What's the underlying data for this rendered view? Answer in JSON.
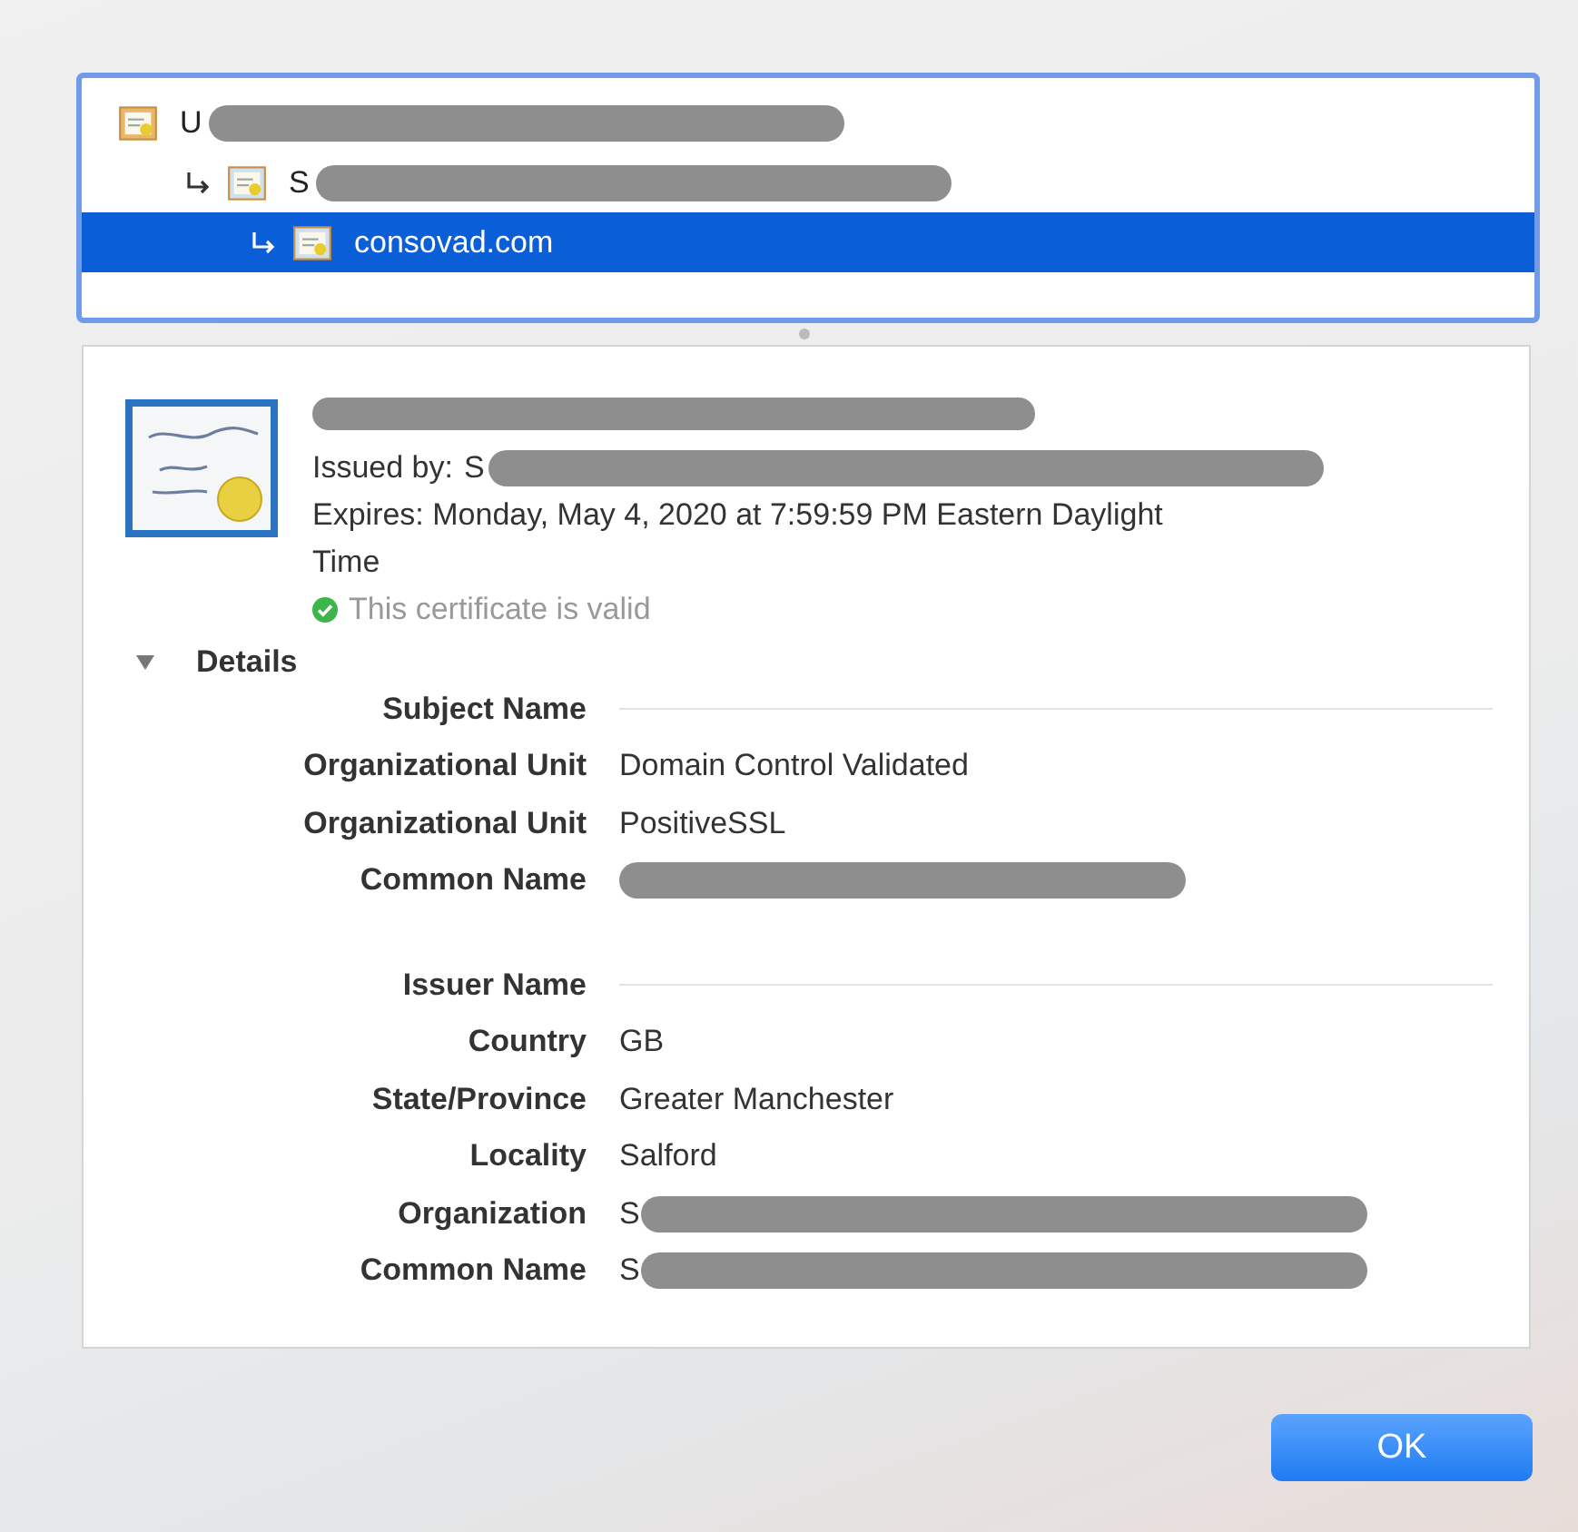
{
  "chain": [
    {
      "label": "U",
      "redacted": true,
      "selected": false,
      "children": [
        {
          "label": "S",
          "redacted": true,
          "selected": false,
          "children": [
            {
              "label": "consovad.com",
              "redacted": false,
              "selected": true
            }
          ]
        }
      ]
    }
  ],
  "certificate": {
    "name_redacted": true,
    "issued_by_label": "Issued by:",
    "issued_by_value": "S",
    "issued_by_redacted": true,
    "expires": "Expires: Monday, May 4, 2020 at 7:59:59 PM Eastern Daylight Time",
    "status": "This certificate is valid",
    "valid": true
  },
  "details": {
    "label": "Details",
    "expanded": true,
    "sections": [
      {
        "heading": "Subject Name",
        "fields": [
          {
            "label": "Organizational Unit",
            "value": "Domain Control Validated",
            "redacted": false
          },
          {
            "label": "Organizational Unit",
            "value": "PositiveSSL",
            "redacted": false
          },
          {
            "label": "Common Name",
            "redacted": true
          }
        ]
      },
      {
        "heading": "Issuer Name",
        "fields": [
          {
            "label": "Country",
            "value": "GB",
            "redacted": false
          },
          {
            "label": "State/Province",
            "value": "Greater Manchester",
            "redacted": false
          },
          {
            "label": "Locality",
            "value": "Salford",
            "redacted": false
          },
          {
            "label": "Organization",
            "value": "S",
            "redacted": true
          },
          {
            "label": "Common Name",
            "value": "S",
            "redacted": true
          }
        ]
      }
    ]
  },
  "buttons": [
    {
      "label": "OK",
      "default": true
    }
  ]
}
